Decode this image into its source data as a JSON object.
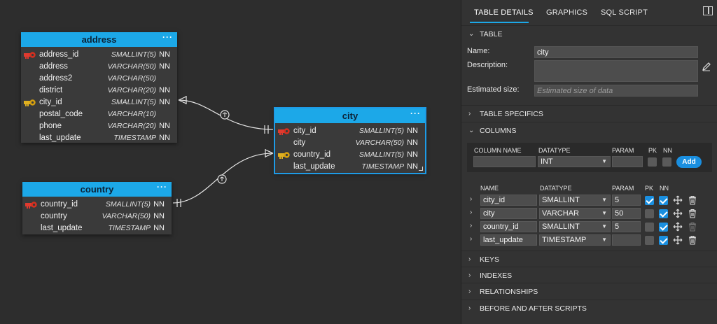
{
  "tables": {
    "address": {
      "title": "address",
      "rows": [
        {
          "name": "address_id",
          "type": "SMALLINT(5)",
          "nn": "NN",
          "key": "pk"
        },
        {
          "name": "address",
          "type": "VARCHAR(50)",
          "nn": "NN",
          "key": ""
        },
        {
          "name": "address2",
          "type": "VARCHAR(50)",
          "nn": "",
          "key": ""
        },
        {
          "name": "district",
          "type": "VARCHAR(20)",
          "nn": "NN",
          "key": ""
        },
        {
          "name": "city_id",
          "type": "SMALLINT(5)",
          "nn": "NN",
          "key": "fk"
        },
        {
          "name": "postal_code",
          "type": "VARCHAR(10)",
          "nn": "",
          "key": ""
        },
        {
          "name": "phone",
          "type": "VARCHAR(20)",
          "nn": "NN",
          "key": ""
        },
        {
          "name": "last_update",
          "type": "TIMESTAMP",
          "nn": "NN",
          "key": ""
        }
      ]
    },
    "city": {
      "title": "city",
      "rows": [
        {
          "name": "city_id",
          "type": "SMALLINT(5)",
          "nn": "NN",
          "key": "pk"
        },
        {
          "name": "city",
          "type": "VARCHAR(50)",
          "nn": "NN",
          "key": ""
        },
        {
          "name": "country_id",
          "type": "SMALLINT(5)",
          "nn": "NN",
          "key": "fk"
        },
        {
          "name": "last_update",
          "type": "TIMESTAMP",
          "nn": "NN",
          "key": ""
        }
      ]
    },
    "country": {
      "title": "country",
      "rows": [
        {
          "name": "country_id",
          "type": "SMALLINT(5)",
          "nn": "NN",
          "key": "pk"
        },
        {
          "name": "country",
          "type": "VARCHAR(50)",
          "nn": "NN",
          "key": ""
        },
        {
          "name": "last_update",
          "type": "TIMESTAMP",
          "nn": "NN",
          "key": ""
        }
      ]
    },
    "menu_glyph": "···"
  },
  "tabs": {
    "details": "TABLE DETAILS",
    "graphics": "GRAPHICS",
    "sql": "SQL SCRIPT"
  },
  "sections": {
    "table": "TABLE",
    "specifics": "TABLE SPECIFICS",
    "columns": "COLUMNS",
    "keys": "KEYS",
    "indexes": "INDEXES",
    "relationships": "RELATIONSHIPS",
    "scripts": "BEFORE AND AFTER SCRIPTS"
  },
  "table_form": {
    "name_label": "Name:",
    "name_value": "city",
    "description_label": "Description:",
    "size_label": "Estimated size:",
    "size_placeholder": "Estimated size of data"
  },
  "new_column": {
    "headers": {
      "name": "COLUMN NAME",
      "datatype": "DATATYPE",
      "param": "PARAM",
      "pk": "PK",
      "nn": "NN"
    },
    "datatype": "INT",
    "add_label": "Add"
  },
  "columns_table": {
    "headers": {
      "name": "NAME",
      "datatype": "DATATYPE",
      "param": "PARAM",
      "pk": "PK",
      "nn": "NN"
    },
    "rows": [
      {
        "name": "city_id",
        "datatype": "SMALLINT",
        "param": "5",
        "pk": true,
        "nn": true
      },
      {
        "name": "city",
        "datatype": "VARCHAR",
        "param": "50",
        "pk": false,
        "nn": true
      },
      {
        "name": "country_id",
        "datatype": "SMALLINT",
        "param": "5",
        "pk": false,
        "nn": true
      },
      {
        "name": "last_update",
        "datatype": "TIMESTAMP",
        "param": "",
        "pk": false,
        "nn": true
      }
    ]
  },
  "colors": {
    "accent": "#1ca8e8",
    "pk_key": "#e03a2f",
    "fk_key": "#e0b020"
  }
}
